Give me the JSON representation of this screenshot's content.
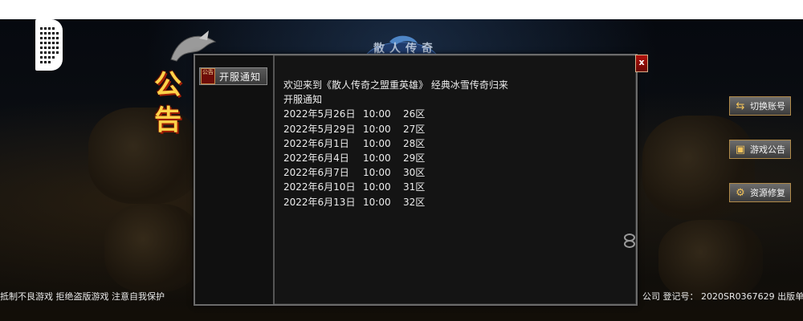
{
  "notice_board": {
    "side_title": "公告",
    "top_banner": "散人传奇",
    "tab_label": "开服通知",
    "tab_badge": "公告",
    "close_label": "x",
    "intro": "欢迎来到《散人传奇之盟重英雄》 经典冰雪传奇归来",
    "section_title": "开服通知",
    "schedule": [
      {
        "date": "2022年5月26日",
        "time": "10:00",
        "zone": "26区"
      },
      {
        "date": "2022年5月29日",
        "time": "10:00",
        "zone": "27区"
      },
      {
        "date": "2022年6月1日",
        "time": "10:00",
        "zone": "28区"
      },
      {
        "date": "2022年6月4日",
        "time": "10:00",
        "zone": "29区"
      },
      {
        "date": "2022年6月7日",
        "time": "10:00",
        "zone": "30区"
      },
      {
        "date": "2022年6月10日",
        "time": "10:00",
        "zone": "31区"
      },
      {
        "date": "2022年6月13日",
        "time": "10:00",
        "zone": "32区"
      }
    ]
  },
  "right_buttons": [
    {
      "label": "切换账号",
      "icon": "swap-icon"
    },
    {
      "label": "游戏公告",
      "icon": "notice-icon"
    },
    {
      "label": "资源修复",
      "icon": "gear-icon"
    }
  ],
  "footer": {
    "left": "抵制不良游戏 拒绝盗版游戏 注意自我保护",
    "right": "公司 登记号： 2020SR0367629 出版单"
  },
  "colors": {
    "panel_bg": "#141414",
    "title_gold": "#ffd34a",
    "close_red": "#b0120c"
  }
}
